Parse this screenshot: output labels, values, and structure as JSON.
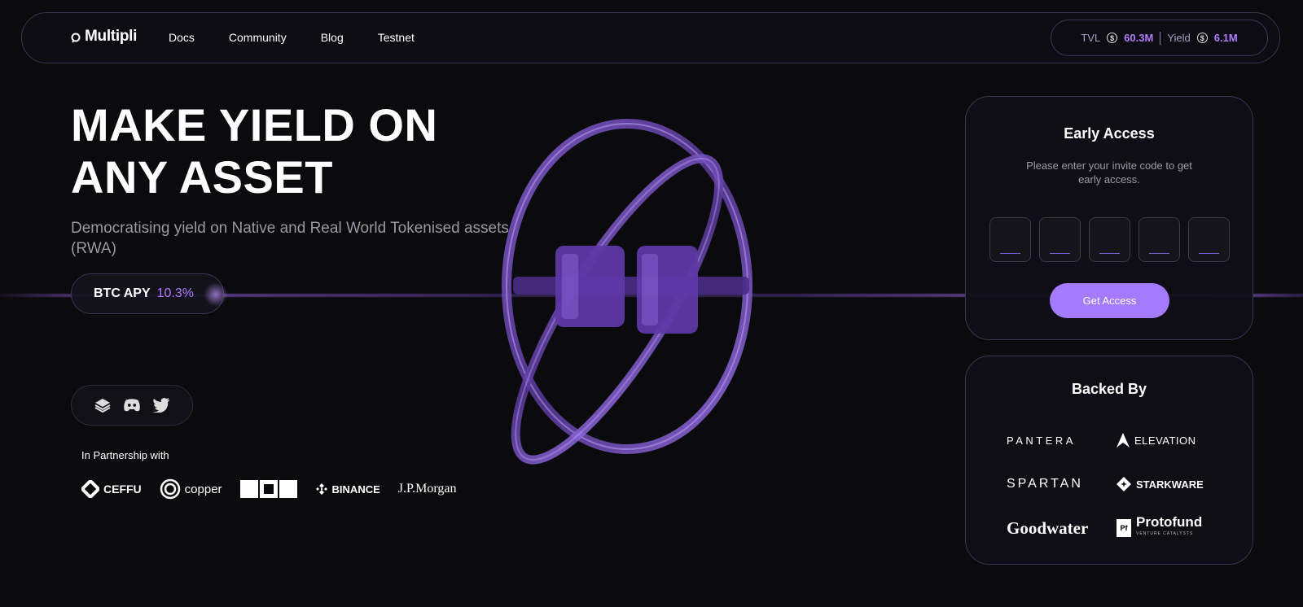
{
  "brand": {
    "name": "Multipli"
  },
  "nav": {
    "links": [
      "Docs",
      "Community",
      "Blog",
      "Testnet"
    ]
  },
  "stats": {
    "tvl_label": "TVL",
    "tvl_value": "60.3M",
    "yield_label": "Yield",
    "yield_value": "6.1M",
    "currency_symbol": "$"
  },
  "hero": {
    "title": "MAKE YIELD ON ANY ASSET",
    "subtitle": "Democratising yield on Native and Real World Tokenised assets (RWA)",
    "apy_label": "BTC APY",
    "apy_value": "10.3%"
  },
  "social": {
    "icons": [
      "gitbook-icon",
      "discord-icon",
      "twitter-icon"
    ]
  },
  "partners": {
    "title": "In Partnership with",
    "items": [
      "CEFFU",
      "copper",
      "OKX",
      "BINANCE",
      "J.P.Morgan"
    ]
  },
  "early_access": {
    "title": "Early Access",
    "description": "Please enter your invite code to get early access.",
    "code_length": 5,
    "button_label": "Get Access"
  },
  "backed_by": {
    "title": "Backed By",
    "backers": [
      "PANTERA",
      "ELEVATION",
      "SPARTAN",
      "STARKWARE",
      "Goodwater",
      "Protofund"
    ],
    "protofund_tagline": "VENTURE CATALYSTS",
    "protofund_mark": "Pf"
  },
  "colors": {
    "accent": "#a47aff",
    "accent_text": "#b07bff",
    "background": "#0b0a0d"
  }
}
